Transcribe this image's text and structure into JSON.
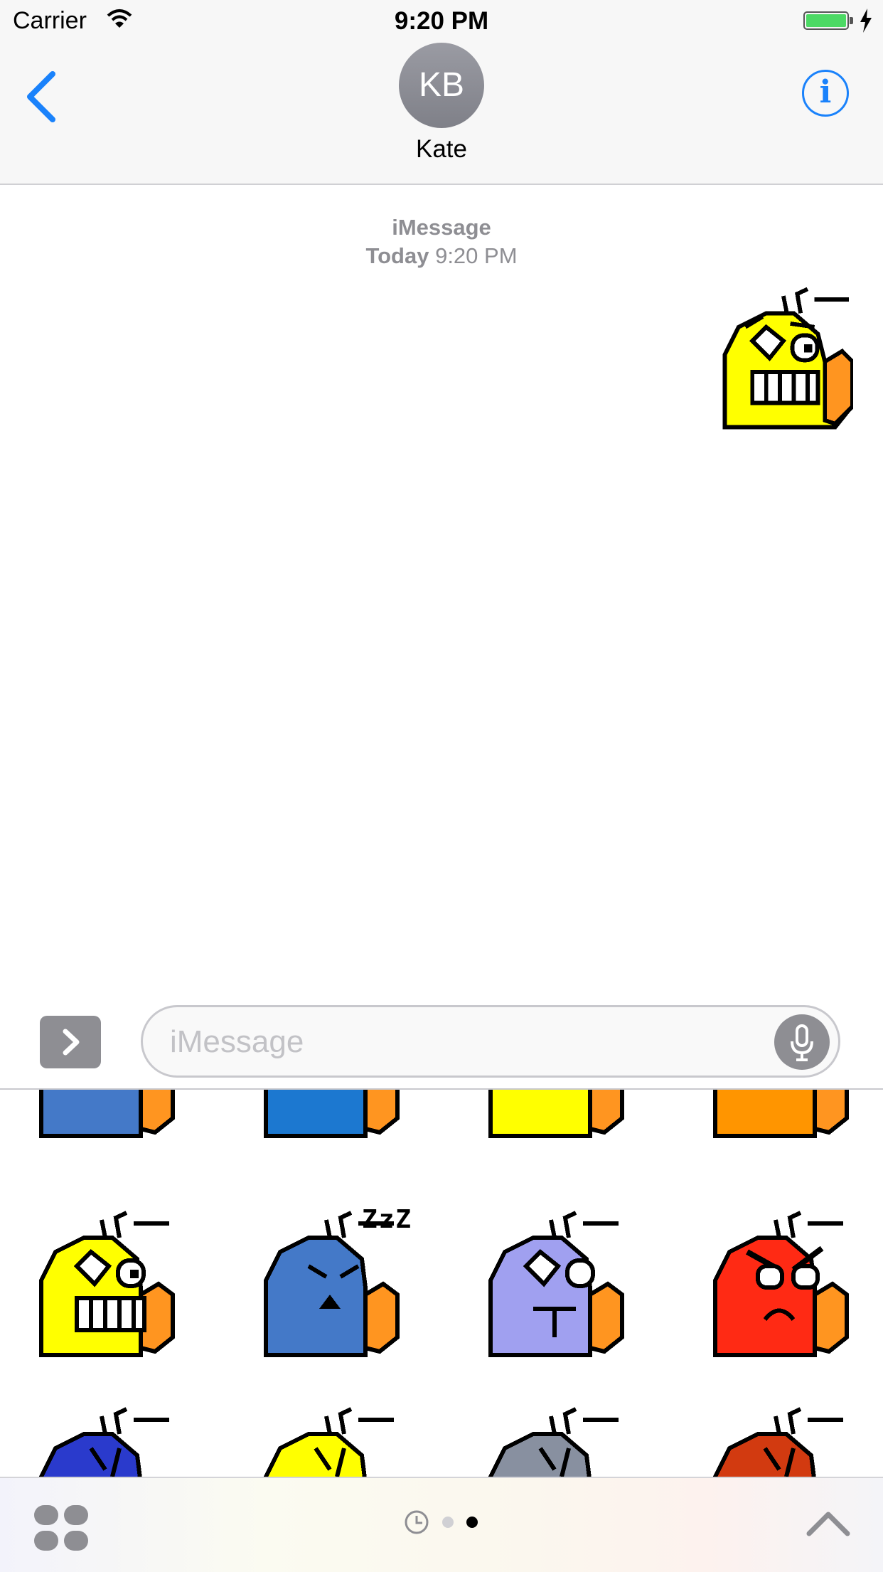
{
  "status_bar": {
    "carrier": "Carrier",
    "time": "9:20 PM",
    "battery_color": "#4cd964"
  },
  "header": {
    "avatar_initials": "KB",
    "contact_name": "Kate",
    "accent_color": "#1a82fb"
  },
  "thread": {
    "service": "iMessage",
    "day": "Today",
    "time": "9:20 PM"
  },
  "input": {
    "placeholder": "iMessage"
  },
  "icons": [
    "wifi-icon",
    "charging-bolt-icon",
    "back-chevron-icon",
    "info-icon",
    "chevron-right-icon",
    "microphone-icon",
    "app-drawer-icon",
    "recents-clock-icon",
    "collapse-chevron-icon"
  ],
  "stickers": {
    "sent": {
      "body_color": "#ffff00",
      "expression": "grin"
    },
    "drawer": [
      {
        "body_color": "#4479c8",
        "expression": "cropped"
      },
      {
        "body_color": "#1c78d0",
        "expression": "cropped"
      },
      {
        "body_color": "#ffff00",
        "expression": "cropped"
      },
      {
        "body_color": "#ff9500",
        "expression": "cropped"
      },
      {
        "body_color": "#ffff00",
        "expression": "grin"
      },
      {
        "body_color": "#4479c8",
        "expression": "sleep",
        "caption": "ZzZ"
      },
      {
        "body_color": "#a0a0f0",
        "expression": "neutral"
      },
      {
        "body_color": "#ff2a14",
        "expression": "angry"
      },
      {
        "body_color": "#2a3acc",
        "expression": "cropped"
      },
      {
        "body_color": "#ffff00",
        "expression": "cropped"
      },
      {
        "body_color": "#8890a0",
        "expression": "cropped"
      },
      {
        "body_color": "#d23a10",
        "expression": "cropped"
      }
    ]
  },
  "page_indicator": {
    "total": 2,
    "active": 2
  }
}
